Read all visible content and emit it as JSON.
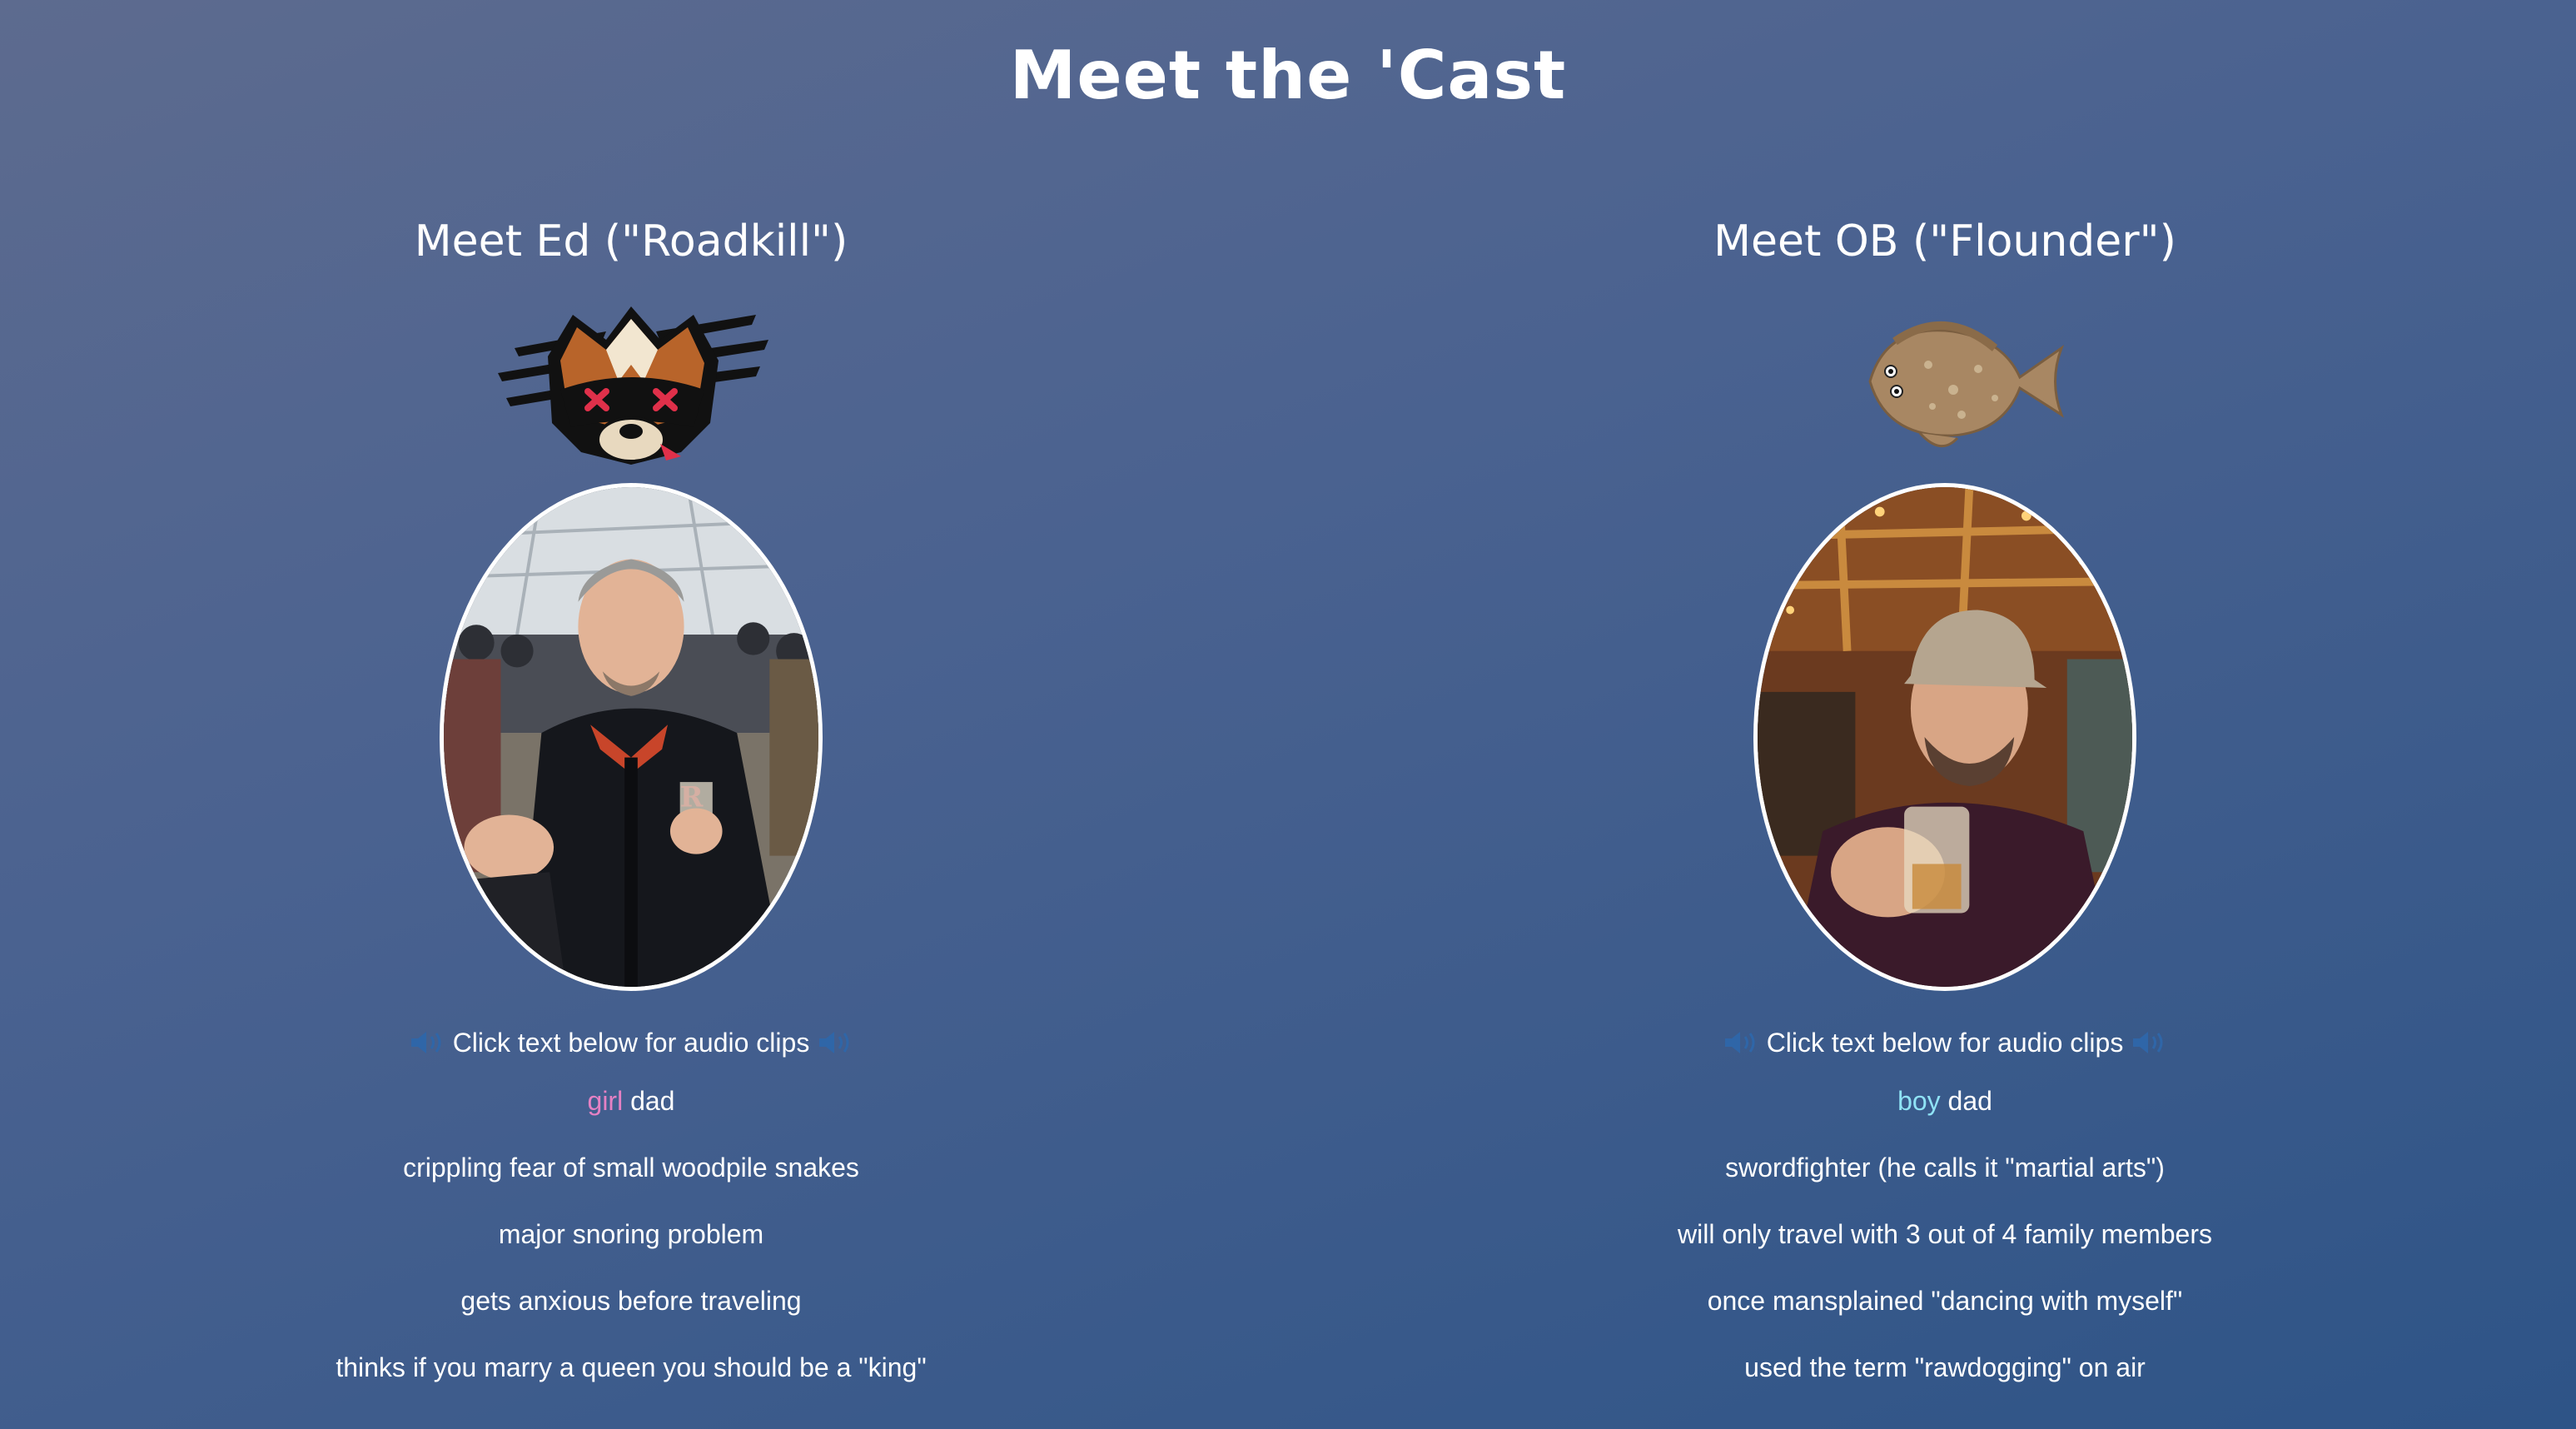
{
  "page": {
    "title": "Meet the 'Cast"
  },
  "cast": [
    {
      "name": "Meet Ed (\"Roadkill\")",
      "mascot_icon": "raccoon-icon",
      "audio_hint": "Click text below for audio clips",
      "first_trait": {
        "highlight": "girl",
        "rest": " dad",
        "highlight_color": "#e681c4"
      },
      "traits": [
        "crippling fear of small woodpile snakes",
        "major snoring problem",
        "gets anxious before traveling",
        "thinks if you marry a queen you should be a \"king\""
      ]
    },
    {
      "name": "Meet OB (\"Flounder\")",
      "mascot_icon": "flounder-fish-icon",
      "audio_hint": "Click text below for audio clips",
      "first_trait": {
        "highlight": "boy",
        "rest": " dad",
        "highlight_color": "#8fe3f5"
      },
      "traits": [
        "swordfighter (he calls it \"martial arts\")",
        "will only travel with 3 out of 4 family members",
        "once mansplained \"dancing with myself\"",
        "used the term \"rawdogging\" on air"
      ]
    }
  ],
  "colors": {
    "speaker_icon": "#2f66a8",
    "background_top": "#5d6b8f",
    "background_bottom": "#2e5487"
  }
}
